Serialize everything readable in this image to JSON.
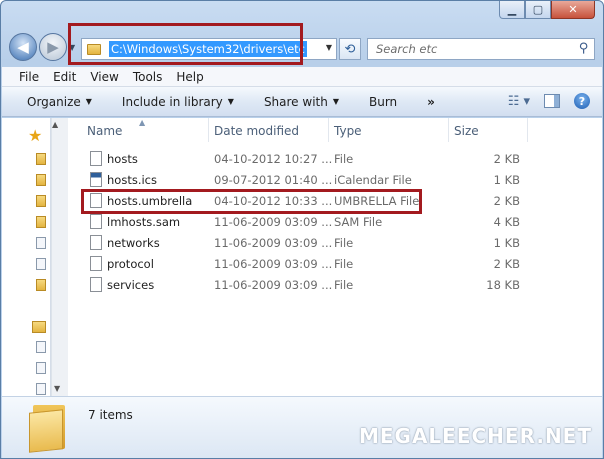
{
  "window": {
    "caption": {
      "minimize": "▁",
      "maximize": "▢",
      "close": "✕"
    }
  },
  "nav": {
    "back": "◀",
    "forward": "▶",
    "address": "C:\\Windows\\System32\\drivers\\etc",
    "search_placeholder": "Search etc",
    "refresh": "⟲"
  },
  "menu": [
    "File",
    "Edit",
    "View",
    "Tools",
    "Help"
  ],
  "commands": [
    {
      "label": "Organize",
      "dropdown": true
    },
    {
      "label": "Include in library",
      "dropdown": true
    },
    {
      "label": "Share with",
      "dropdown": true
    },
    {
      "label": "Burn",
      "dropdown": false
    },
    {
      "label": "»",
      "dropdown": false
    }
  ],
  "columns": {
    "name": "Name",
    "date": "Date modified",
    "type": "Type",
    "size": "Size"
  },
  "files": [
    {
      "name": "hosts",
      "date": "04-10-2012 10:27 ...",
      "type": "File",
      "size": "2 KB",
      "icon": "file-icon"
    },
    {
      "name": "hosts.ics",
      "date": "09-07-2012 01:40 ...",
      "type": "iCalendar File",
      "size": "1 KB",
      "icon": "calendar-file-icon"
    },
    {
      "name": "hosts.umbrella",
      "date": "04-10-2012 10:33 ...",
      "type": "UMBRELLA File",
      "size": "2 KB",
      "icon": "file-icon"
    },
    {
      "name": "lmhosts.sam",
      "date": "11-06-2009 03:09 ...",
      "type": "SAM File",
      "size": "4 KB",
      "icon": "file-icon"
    },
    {
      "name": "networks",
      "date": "11-06-2009 03:09 ...",
      "type": "File",
      "size": "1 KB",
      "icon": "file-icon"
    },
    {
      "name": "protocol",
      "date": "11-06-2009 03:09 ...",
      "type": "File",
      "size": "2 KB",
      "icon": "file-icon"
    },
    {
      "name": "services",
      "date": "11-06-2009 03:09 ...",
      "type": "File",
      "size": "18 KB",
      "icon": "file-icon"
    }
  ],
  "details": {
    "item_count": "7 items"
  },
  "watermark": "MEGALEECHER.NET",
  "colors": {
    "highlight_box": "#a31a1f",
    "address_selection": "#3399ff"
  }
}
